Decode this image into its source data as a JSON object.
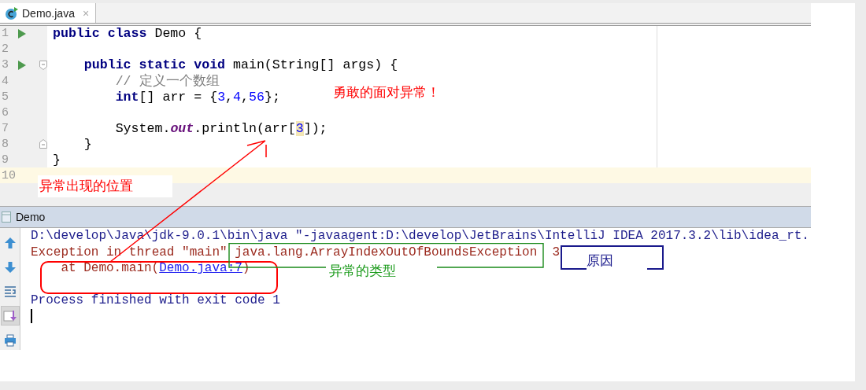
{
  "tabs": [
    {
      "label": "Demo.java",
      "close": "×",
      "selected": true
    }
  ],
  "editor": {
    "lines": [
      {
        "number": "1",
        "run": true,
        "fold_open": false,
        "fold_close": false,
        "current": false,
        "tokens": [
          {
            "kind": "kw",
            "text": "public class "
          },
          {
            "kind": "plain",
            "text": "Demo {"
          }
        ]
      },
      {
        "number": "2",
        "run": false,
        "fold_open": false,
        "fold_close": false,
        "current": false
      },
      {
        "number": "3",
        "run": true,
        "fold_open": true,
        "fold_close": false,
        "current": false,
        "tokens": [
          {
            "kind": "kw",
            "text": "    public static void "
          },
          {
            "kind": "plain",
            "text": "main(String[] args) {"
          }
        ]
      },
      {
        "number": "4",
        "run": false,
        "fold_open": false,
        "fold_close": false,
        "current": false,
        "tokens": [
          {
            "kind": "comment",
            "text": "        // 定义一个数组"
          }
        ]
      },
      {
        "number": "5",
        "run": false,
        "fold_open": false,
        "fold_close": false,
        "current": false,
        "tokens": [
          {
            "kind": "kw",
            "text": "        int"
          },
          {
            "kind": "plain",
            "text": "[] arr = {"
          },
          {
            "kind": "num",
            "text": "3"
          },
          {
            "kind": "plain",
            "text": ","
          },
          {
            "kind": "num",
            "text": "4"
          },
          {
            "kind": "plain",
            "text": ","
          },
          {
            "kind": "num",
            "text": "56"
          },
          {
            "kind": "plain",
            "text": "};"
          }
        ]
      },
      {
        "number": "6",
        "run": false,
        "fold_open": false,
        "fold_close": false,
        "current": false
      },
      {
        "number": "7",
        "run": false,
        "fold_open": false,
        "fold_close": false,
        "current": false,
        "tokens": [
          {
            "kind": "plain",
            "text": "        System."
          },
          {
            "kind": "field",
            "text": "out"
          },
          {
            "kind": "plain",
            "text": ".println(arr["
          },
          {
            "kind": "match",
            "text": "3"
          },
          {
            "kind": "plain",
            "text": "]);"
          }
        ]
      },
      {
        "number": "8",
        "run": false,
        "fold_open": false,
        "fold_close": true,
        "current": false,
        "tokens": [
          {
            "kind": "plain",
            "text": "    }"
          }
        ]
      },
      {
        "number": "9",
        "run": false,
        "fold_open": false,
        "fold_close": false,
        "current": false,
        "tokens": [
          {
            "kind": "plain",
            "text": "}"
          }
        ]
      },
      {
        "number": "10",
        "run": false,
        "fold_open": false,
        "fold_close": false,
        "current": true
      }
    ]
  },
  "run_panel": {
    "title": "Demo",
    "toolbar": [
      {
        "kind": "up",
        "selected": false
      },
      {
        "kind": "down",
        "selected": false
      },
      {
        "kind": "wrap",
        "selected": false
      },
      {
        "kind": "scroll",
        "selected": true
      },
      {
        "kind": "print",
        "selected": false
      }
    ],
    "lines": [
      {
        "blank_before": false,
        "tokens": [
          {
            "kind": "info",
            "text": "D:\\develop\\Java\\jdk-9.0.1\\bin\\java \"-javaagent:D:\\develop\\JetBrains\\IntelliJ IDEA 2017.3.2\\lib\\idea_rt."
          }
        ]
      },
      {
        "blank_before": false,
        "tokens": [
          {
            "kind": "error",
            "text": "Exception in thread \"main\""
          },
          {
            "kind": "exception",
            "text": "java.lang.ArrayIndexOutOfBoundsException"
          },
          {
            "kind": "reason",
            "text": "3"
          }
        ]
      },
      {
        "blank_before": false,
        "tokens": [
          {
            "kind": "trace",
            "text": "at Demo.main("
          },
          {
            "kind": "link",
            "text": "Demo.java:7"
          },
          {
            "kind": "error",
            "text": ")"
          }
        ]
      },
      {
        "blank_before": true,
        "tokens": [
          {
            "kind": "info",
            "text": "Process finished with exit code 1"
          }
        ]
      }
    ],
    "caret": true
  },
  "annotations": [
    {
      "text": "勇敢的面对异常！",
      "color": "#ff0000"
    },
    {
      "text": "异常出现的位置",
      "color": "#ff0000"
    },
    {
      "text": "异常的类型",
      "color": "#1a9a1a"
    },
    {
      "text": "原因",
      "color": "#1a1a8c"
    }
  ]
}
